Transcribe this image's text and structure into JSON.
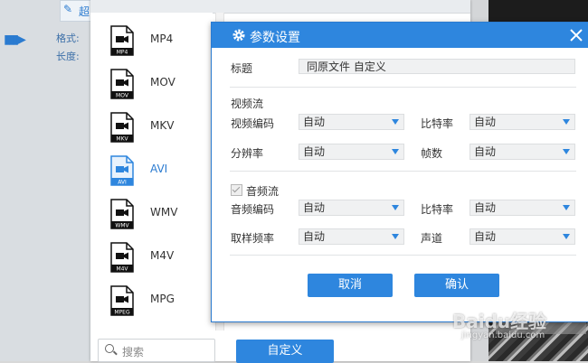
{
  "background": {
    "edit_button_label": "超",
    "format_label": "格式:",
    "length_label": "长度:"
  },
  "format_list": {
    "items": [
      {
        "name": "MP4",
        "badge": "MP4"
      },
      {
        "name": "MOV",
        "badge": "MOV"
      },
      {
        "name": "MKV",
        "badge": "MKV"
      },
      {
        "name": "AVI",
        "badge": "AVI",
        "selected": true
      },
      {
        "name": "WMV",
        "badge": "WMV"
      },
      {
        "name": "M4V",
        "badge": "M4V"
      },
      {
        "name": "MPG",
        "badge": "MPEG"
      }
    ],
    "search_placeholder": "搜索",
    "custom_button": "自定义"
  },
  "dialog": {
    "title": "参数设置",
    "title_label": "标题",
    "title_value": "同原文件 自定义",
    "video_section": "视频流",
    "video_codec_label": "视频编码",
    "video_codec_value": "自动",
    "video_bitrate_label": "比特率",
    "video_bitrate_value": "自动",
    "resolution_label": "分辨率",
    "resolution_value": "自动",
    "framerate_label": "帧数",
    "framerate_value": "自动",
    "audio_section": "音频流",
    "audio_enabled": true,
    "audio_codec_label": "音频编码",
    "audio_codec_value": "自动",
    "audio_bitrate_label": "比特率",
    "audio_bitrate_value": "自动",
    "samplerate_label": "取样频率",
    "samplerate_value": "自动",
    "channel_label": "声道",
    "channel_value": "自动",
    "cancel_button": "取消",
    "ok_button": "确认"
  },
  "watermark": {
    "text": "Baidu经验",
    "sub": "jingyan.baidu.com"
  },
  "colors": {
    "accent": "#2e86de",
    "selected_text": "#2b7bd0"
  }
}
